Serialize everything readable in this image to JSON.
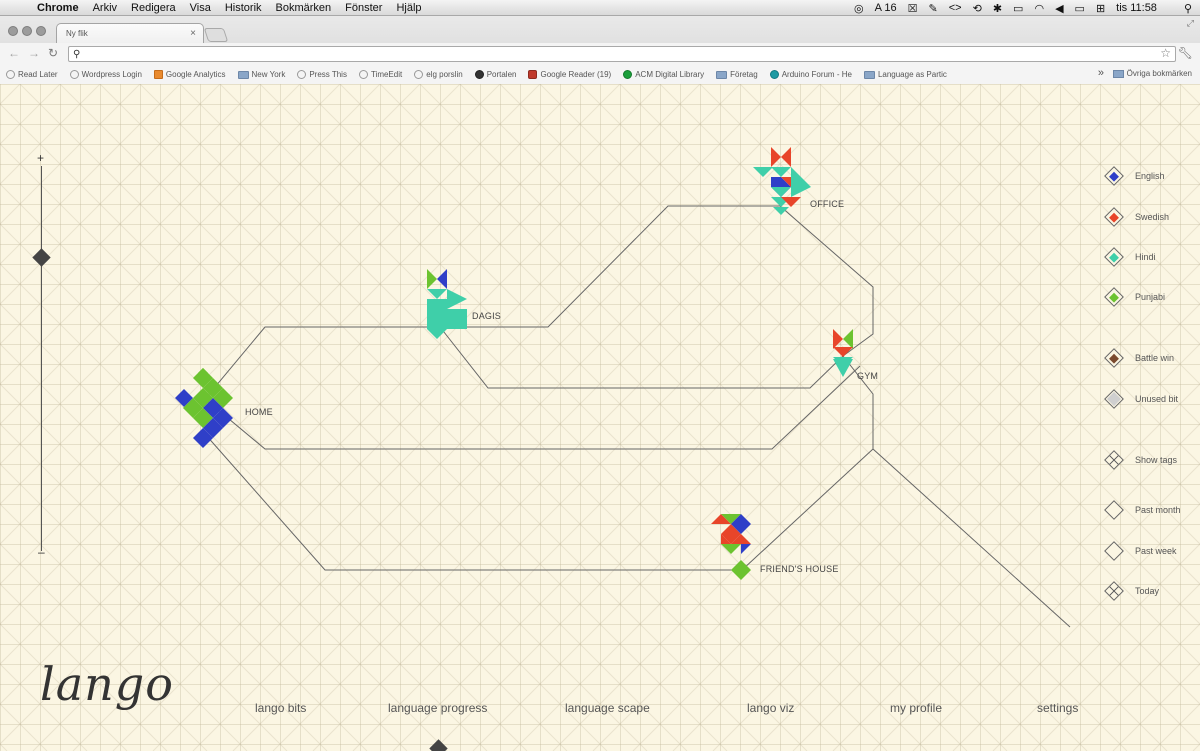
{
  "menubar": {
    "app": "Chrome",
    "items": [
      "Arkiv",
      "Redigera",
      "Visa",
      "Historik",
      "Bokmärken",
      "Fönster",
      "Hjälp"
    ],
    "status": {
      "adobe": "16",
      "clock": "tis 11:58"
    }
  },
  "browser": {
    "tab_title": "Ny flik",
    "address": "",
    "bookmarks": [
      {
        "label": "Read Later",
        "icon": "globe-icon"
      },
      {
        "label": "Wordpress Login",
        "icon": "globe-icon"
      },
      {
        "label": "Google Analytics",
        "icon": "analytics-icon"
      },
      {
        "label": "New York",
        "icon": "folder-icon"
      },
      {
        "label": "Press This",
        "icon": "globe-icon"
      },
      {
        "label": "TimeEdit",
        "icon": "globe-icon"
      },
      {
        "label": "elg porslin",
        "icon": "globe-icon"
      },
      {
        "label": "Portalen",
        "icon": "paw-icon"
      },
      {
        "label": "Google Reader (19)",
        "icon": "reader-icon"
      },
      {
        "label": "ACM Digital Library",
        "icon": "acm-icon"
      },
      {
        "label": "Företag",
        "icon": "folder-icon"
      },
      {
        "label": "Arduino Forum - He",
        "icon": "arduino-icon"
      },
      {
        "label": "Language as Partic",
        "icon": "folder-icon"
      }
    ],
    "other_bookmarks": "Övriga bokmärken"
  },
  "zoom": {
    "plus": "+",
    "minus": "–",
    "level": 0.23
  },
  "places": [
    {
      "name": "HOME"
    },
    {
      "name": "DAGIS"
    },
    {
      "name": "OFFICE"
    },
    {
      "name": "GYM"
    },
    {
      "name": "FRIEND'S HOUSE"
    }
  ],
  "legend": {
    "languages": [
      {
        "label": "English",
        "color": "#2f3fc8"
      },
      {
        "label": "Swedish",
        "color": "#e8452a"
      },
      {
        "label": "Hindi",
        "color": "#3fcfa9"
      },
      {
        "label": "Punjabi",
        "color": "#6cc330"
      }
    ],
    "types": [
      {
        "label": "Battle win",
        "color": "#7a4a2e"
      },
      {
        "label": "Unused bit",
        "color": "#cfcfcf"
      }
    ],
    "filters": [
      {
        "label": "Show tags",
        "icon": "grid-diamond-icon"
      },
      {
        "label": "Past month",
        "icon": "empty-diamond-icon"
      },
      {
        "label": "Past week",
        "icon": "empty-diamond-icon"
      },
      {
        "label": "Today",
        "icon": "grid-diamond-icon"
      }
    ]
  },
  "footer": {
    "logo": "lango",
    "nav": [
      "lango bits",
      "language progress",
      "language scape",
      "lango viz",
      "my profile",
      "settings"
    ]
  },
  "colors": {
    "english": "#2f3fc8",
    "swedish": "#e8452a",
    "hindi": "#3fcfa9",
    "punjabi": "#6cc330",
    "background": "#fbf6e3"
  }
}
